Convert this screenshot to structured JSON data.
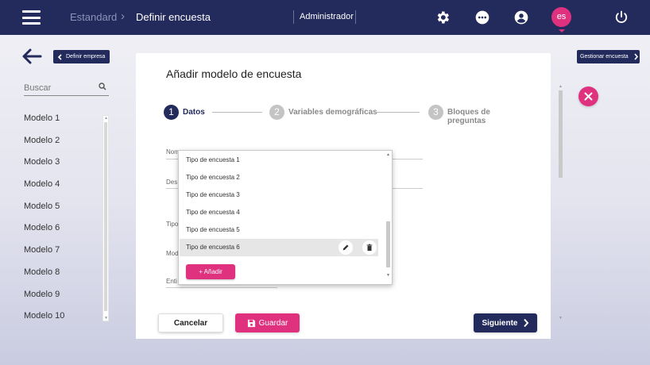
{
  "header": {
    "breadcrumb_1": "Estandard",
    "breadcrumb_2": "Definir encuesta",
    "role": "Administrador",
    "lang": "es"
  },
  "nav": {
    "back_button_label": "Definir empresa",
    "manage_button_label": "Gestionar encuesta"
  },
  "search": {
    "placeholder": "Buscar"
  },
  "models": [
    "Modelo 1",
    "Modelo 2",
    "Modelo 3",
    "Modelo 4",
    "Modelo 5",
    "Modelo 6",
    "Modelo 7",
    "Modelo 8",
    "Modelo 9",
    "Modelo 10"
  ],
  "card": {
    "title": "Añadir modelo de encuesta",
    "steps": [
      {
        "number": "1",
        "label": "Datos",
        "active": true
      },
      {
        "number": "2",
        "label": "Variables demográficas",
        "active": false
      },
      {
        "number": "3",
        "label": "Bloques de preguntas",
        "active": false
      }
    ],
    "field_labels": [
      "Nom",
      "Des",
      "Tipo",
      "Mod",
      "Enti"
    ]
  },
  "dropdown": {
    "items": [
      "Tipo de encuesta 1",
      "Tipo de encuesta 2",
      "Tipo de encuesta 3",
      "Tipo de encuesta 4",
      "Tipo de encuesta 5",
      "Tipo de encuesta 6"
    ],
    "selected_index": 5,
    "add_label": "+ Añadir"
  },
  "buttons": {
    "cancel": "Cancelar",
    "save": "Guardar",
    "next": "Siguiente"
  },
  "colors": {
    "navy": "#232a5c",
    "accent_pink": "#e0317f",
    "inactive_step": "#c4c4c4"
  }
}
